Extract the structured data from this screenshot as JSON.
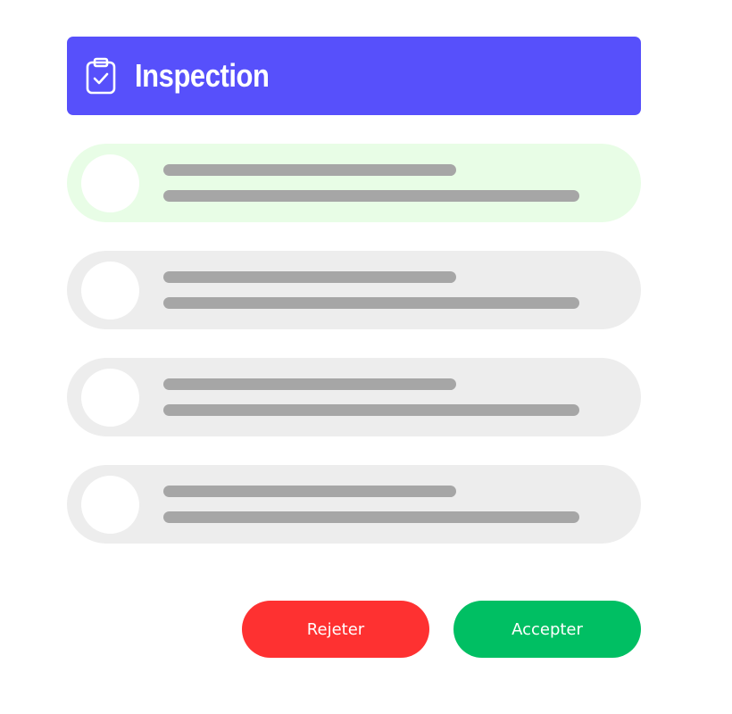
{
  "header": {
    "title": "Inspection",
    "icon": "clipboard-check-icon",
    "color": "#5750fb"
  },
  "items": [
    {
      "state": "selected",
      "background": "#e8fde6"
    },
    {
      "state": "default",
      "background": "#ededed"
    },
    {
      "state": "default",
      "background": "#ededed"
    },
    {
      "state": "default",
      "background": "#ededed"
    }
  ],
  "actions": {
    "reject_label": "Rejeter",
    "reject_color": "#fe3131",
    "accept_label": "Accepter",
    "accept_color": "#00bf63"
  }
}
